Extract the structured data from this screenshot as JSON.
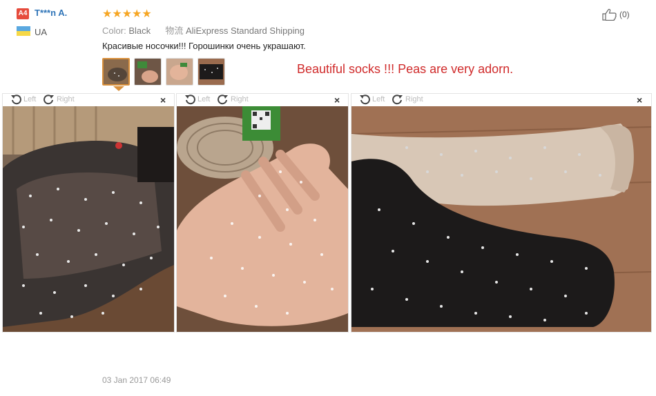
{
  "reviewer": {
    "badge": "A4",
    "name": "T***n A.",
    "country": "UA"
  },
  "rating": {
    "stars": "★★★★★",
    "value": 5
  },
  "attributes": {
    "color_label": "Color:",
    "color_value": "Black",
    "shipping_label": "物流",
    "shipping_value": "AliExpress Standard Shipping"
  },
  "review": {
    "text": "Красивые носочки!!! Горошинки очень украшают.",
    "translation": "Beautiful socks !!! Peas are very adorn.",
    "date": "03 Jan 2017 06:49"
  },
  "helpful": {
    "count": "(0)"
  },
  "viewer": {
    "rotate_left_label": "Left",
    "rotate_right_label": "Right",
    "close_glyph": "×"
  },
  "colors": {
    "username": "#2f74b8",
    "badge": "#e64b3c",
    "stars": "#f6a623",
    "translation": "#d02b2b",
    "selected_thumb": "#d9903b"
  },
  "icons": [
    "thumbs-up-icon",
    "rotate-left-icon",
    "rotate-right-icon",
    "close-icon"
  ]
}
